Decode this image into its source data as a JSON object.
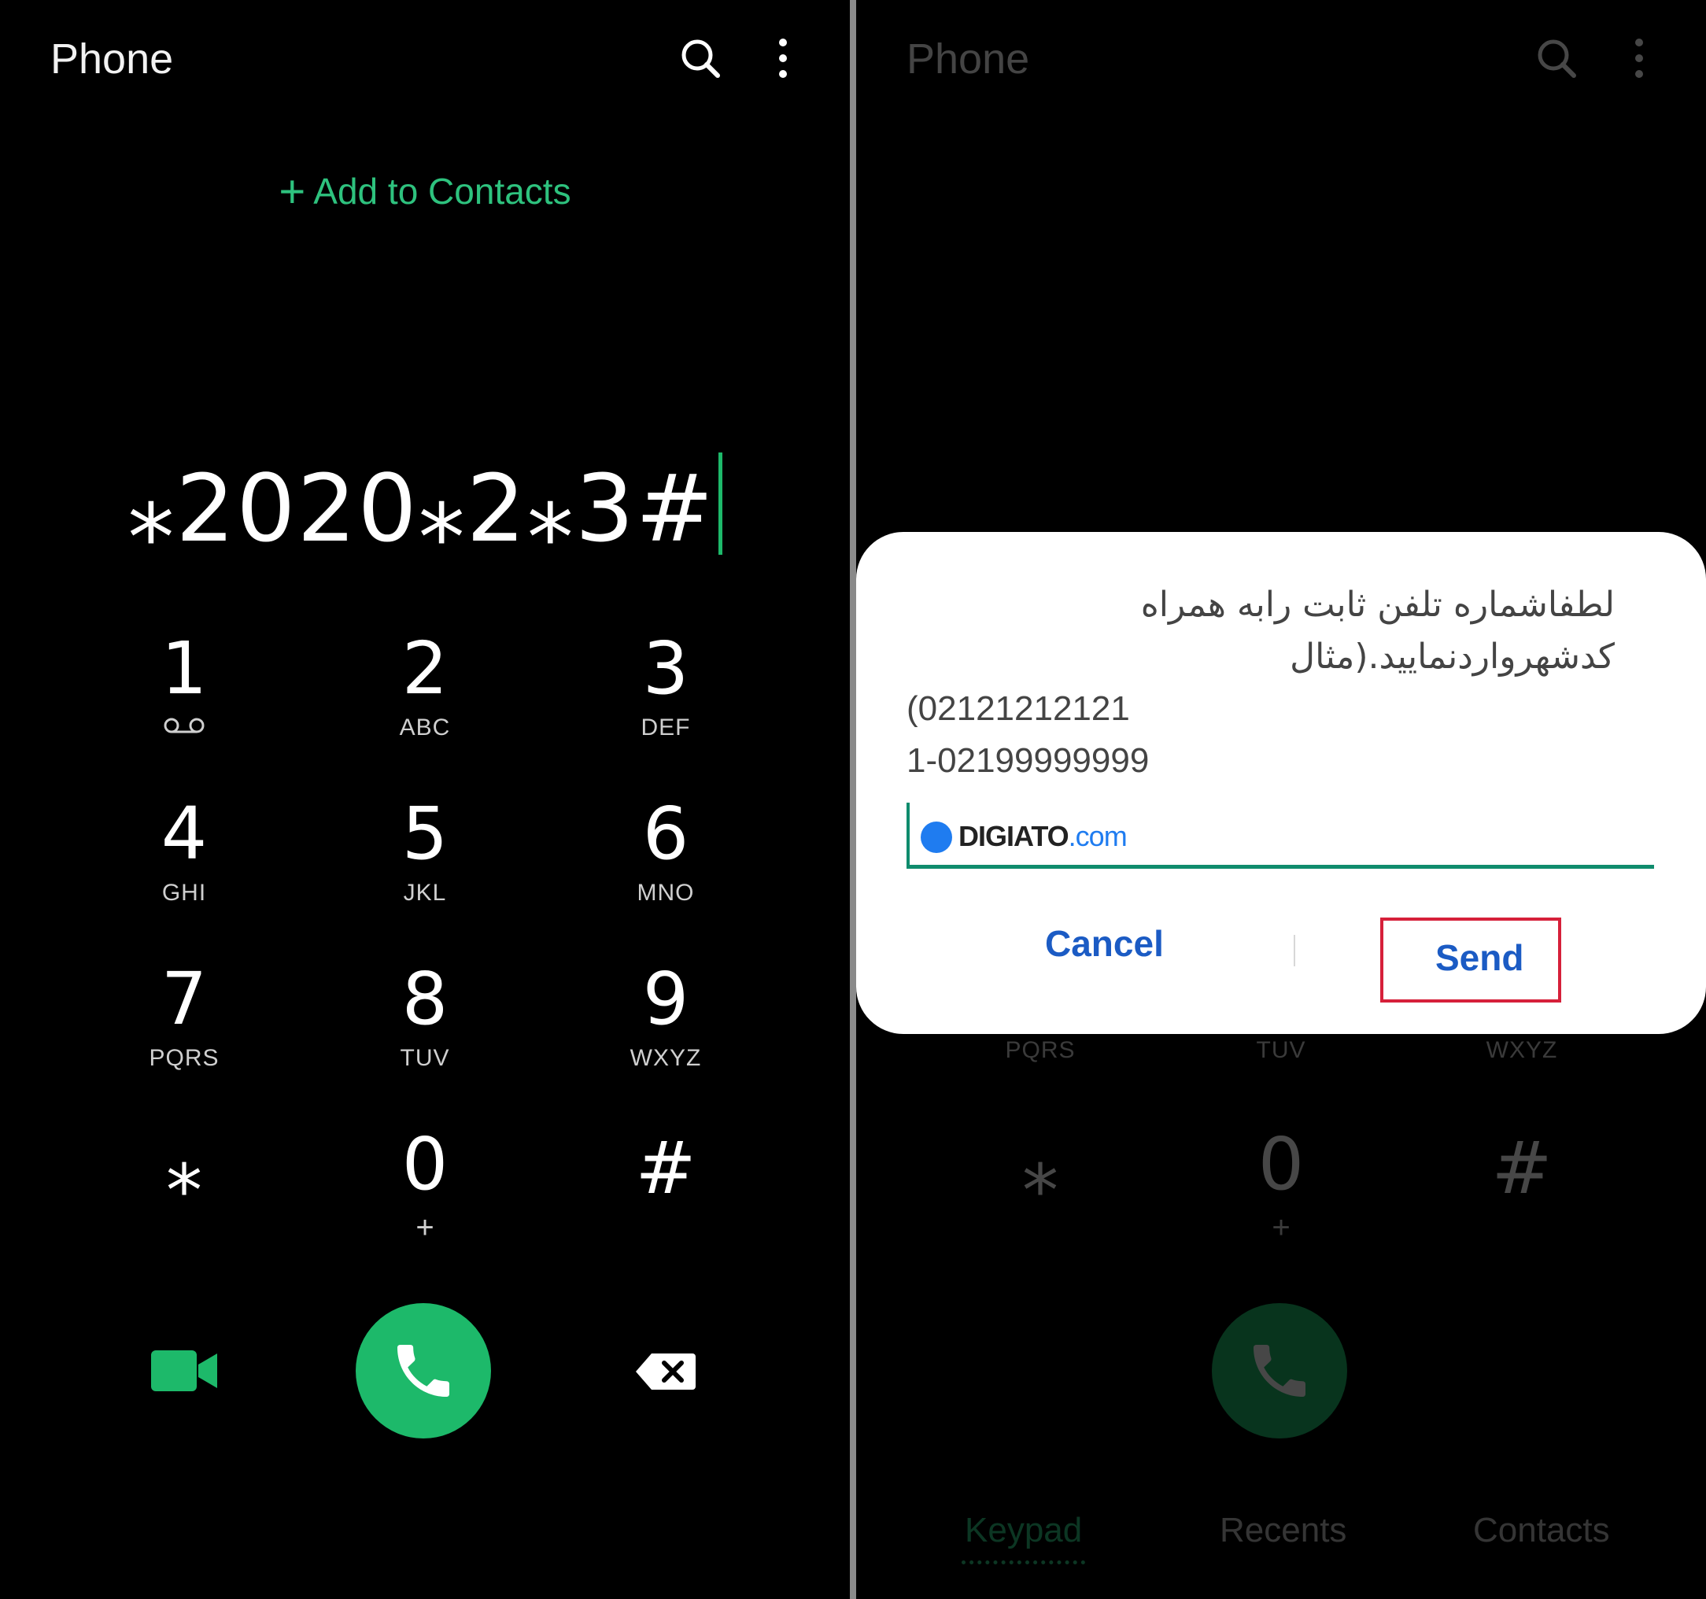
{
  "left_screen": {
    "title": "Phone",
    "add_contacts": "Add to Contacts",
    "dialed_number": "⁎2020⁎2⁎3#",
    "keys": [
      {
        "digit": "1",
        "letters": ""
      },
      {
        "digit": "2",
        "letters": "ABC"
      },
      {
        "digit": "3",
        "letters": "DEF"
      },
      {
        "digit": "4",
        "letters": "GHI"
      },
      {
        "digit": "5",
        "letters": "JKL"
      },
      {
        "digit": "6",
        "letters": "MNO"
      },
      {
        "digit": "7",
        "letters": "PQRS"
      },
      {
        "digit": "8",
        "letters": "TUV"
      },
      {
        "digit": "9",
        "letters": "WXYZ"
      },
      {
        "digit": "⁎",
        "letters": ""
      },
      {
        "digit": "0",
        "letters": "+"
      },
      {
        "digit": "#",
        "letters": ""
      }
    ]
  },
  "right_screen": {
    "title": "Phone",
    "dialog": {
      "message_rtl": "لطفاشماره تلفن ثابت رابه همراه کدشهرواردنمایید.(مثال",
      "message_line2": "(02121212121",
      "message_line3": "1-02199999999",
      "watermark_name": "DIGIATO",
      "watermark_tld": ".com",
      "cancel_label": "Cancel",
      "send_label": "Send"
    },
    "visible_keys": [
      {
        "digit": "",
        "letters": "PQRS"
      },
      {
        "digit": "",
        "letters": "TUV"
      },
      {
        "digit": "",
        "letters": "WXYZ"
      },
      {
        "digit": "⁎",
        "letters": ""
      },
      {
        "digit": "0",
        "letters": "+"
      },
      {
        "digit": "#",
        "letters": ""
      }
    ],
    "tabs": [
      {
        "label": "Keypad",
        "active": true
      },
      {
        "label": "Recents",
        "active": false
      },
      {
        "label": "Contacts",
        "active": false
      }
    ]
  },
  "colors": {
    "accent_green": "#1db96a",
    "dialog_button_blue": "#1b5bc4",
    "highlight_red": "#d6203a",
    "input_underline": "#0f8c6d"
  }
}
